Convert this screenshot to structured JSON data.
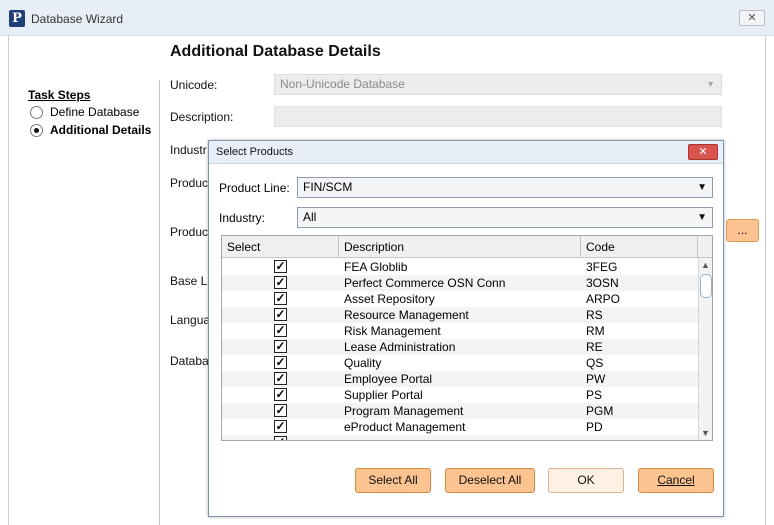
{
  "window": {
    "title": "Database Wizard",
    "logo_letter": "P",
    "close_glyph": "✕"
  },
  "page": {
    "heading": "Additional Database Details"
  },
  "task_steps": {
    "title": "Task Steps",
    "steps": [
      {
        "label": "Define Database",
        "selected": false
      },
      {
        "label": "Additional Details",
        "selected": true
      }
    ]
  },
  "form": {
    "unicode_label": "Unicode:",
    "unicode_value": "Non-Unicode Database",
    "description_label": "Description:",
    "industry_label": "Industr",
    "product_label_1": "Produc",
    "product_label_2": "Produc",
    "base_label": "Base L",
    "language_label": "Langua",
    "database_label": "Databa",
    "ellipsis_label": "..."
  },
  "dialog": {
    "title": "Select Products",
    "close_glyph": "✕",
    "product_line_label": "Product Line:",
    "product_line_value": "FIN/SCM",
    "industry_label": "Industry:",
    "industry_value": "All",
    "columns": {
      "select": "Select",
      "description": "Description",
      "code": "Code"
    },
    "rows": [
      {
        "description": "FEA Globlib",
        "code": "3FEG",
        "checked": true
      },
      {
        "description": "Perfect Commerce OSN Conn",
        "code": "3OSN",
        "checked": true
      },
      {
        "description": "Asset Repository",
        "code": "ARPO",
        "checked": true
      },
      {
        "description": "Resource Management",
        "code": "RS",
        "checked": true
      },
      {
        "description": "Risk Management",
        "code": "RM",
        "checked": true
      },
      {
        "description": "Lease Administration",
        "code": "RE",
        "checked": true
      },
      {
        "description": "Quality",
        "code": "QS",
        "checked": true
      },
      {
        "description": "Employee Portal",
        "code": "PW",
        "checked": true
      },
      {
        "description": "Supplier Portal",
        "code": "PS",
        "checked": true
      },
      {
        "description": "Program Management",
        "code": "PGM",
        "checked": true
      },
      {
        "description": "eProduct Management",
        "code": "PD",
        "checked": true
      }
    ],
    "buttons": {
      "select_all": "Select All",
      "deselect_all": "Deselect All",
      "ok": "OK",
      "cancel": "Cancel"
    }
  }
}
